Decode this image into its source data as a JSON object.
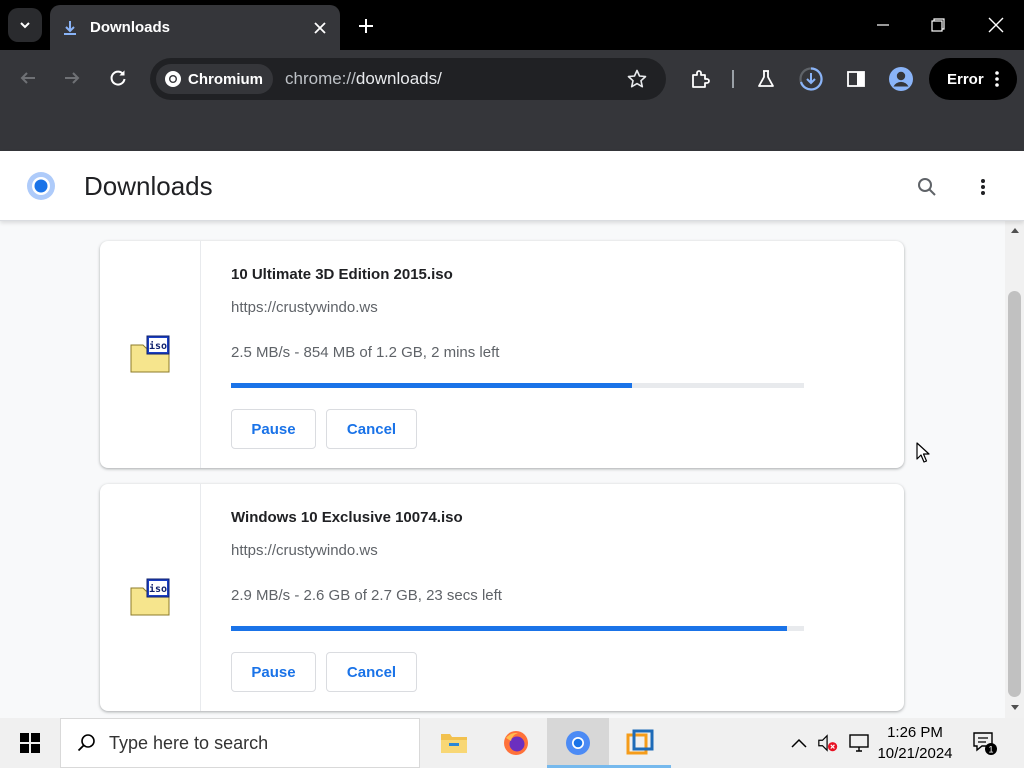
{
  "browser": {
    "tab": {
      "title": "Downloads"
    },
    "omnibox": {
      "site_chip": "Chromium",
      "url_prefix": "chrome://",
      "url_host": "downloads/"
    },
    "profile_button": {
      "label": "Error"
    }
  },
  "page": {
    "title": "Downloads"
  },
  "downloads": [
    {
      "file_name": "10 Ultimate 3D Edition 2015.iso",
      "url": "https://crustywindo.ws",
      "status": "2.5 MB/s - 854 MB of 1.2 GB, 2 mins left",
      "progress": 0.7,
      "pause_label": "Pause",
      "cancel_label": "Cancel"
    },
    {
      "file_name": "Windows 10 Exclusive 10074.iso",
      "url": "https://crustywindo.ws",
      "status": "2.9 MB/s - 2.6 GB of 2.7 GB, 23 secs left",
      "progress": 0.97,
      "pause_label": "Pause",
      "cancel_label": "Cancel"
    }
  ],
  "taskbar": {
    "search_placeholder": "Type here to search",
    "time": "1:26 PM",
    "date": "10/21/2024",
    "notification_count": "1"
  },
  "colors": {
    "accent": "#1a73e8",
    "chrome_dark": "#35363a",
    "page_bg": "#f8f9fa"
  }
}
